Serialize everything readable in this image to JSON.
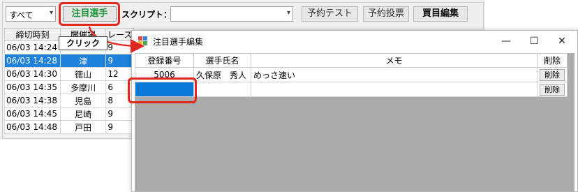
{
  "main": {
    "venue_filter": "すべて",
    "watch_button": "注目選手",
    "script_label": "スクリプト：",
    "script_value": "",
    "buttons": {
      "test": "予約テスト",
      "vote": "予約投票",
      "edit": "買目編集"
    },
    "grid": {
      "headers": [
        "締切時刻",
        "開催場",
        "レース"
      ],
      "rows": [
        {
          "time": "06/03 14:24",
          "venue": "",
          "race": "9"
        },
        {
          "time": "06/03 14:28",
          "venue": "津",
          "race": "9"
        },
        {
          "time": "06/03 14:30",
          "venue": "徳山",
          "race": "12"
        },
        {
          "time": "06/03 14:35",
          "venue": "多摩川",
          "race": "6"
        },
        {
          "time": "06/03 14:38",
          "venue": "児島",
          "race": "8"
        },
        {
          "time": "06/03 14:45",
          "venue": "尼崎",
          "race": "9"
        },
        {
          "time": "06/03 14:48",
          "venue": "戸田",
          "race": "9"
        }
      ]
    }
  },
  "annotation": {
    "click_label": "クリック",
    "highlight_color": "#e0261f"
  },
  "dialog": {
    "title": "注目選手編集",
    "controls": {
      "minimize": "—",
      "maximize": "☐",
      "close": "✕"
    },
    "headers": [
      "登録番号",
      "選手氏名",
      "メモ",
      "削除"
    ],
    "rows": [
      {
        "number": "5006",
        "name": "久保原　秀人",
        "memo": "めっさ速い",
        "delete": "削除"
      },
      {
        "number": "",
        "name": "",
        "memo": "",
        "delete": "削除"
      }
    ],
    "selection_color": "#0a78d7"
  }
}
